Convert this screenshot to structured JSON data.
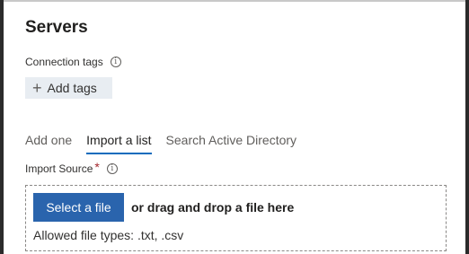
{
  "panel": {
    "title": "Servers"
  },
  "connection_tags": {
    "label": "Connection tags",
    "add_button": "Add tags"
  },
  "tabs": [
    {
      "label": "Add one",
      "active": false
    },
    {
      "label": "Import a list",
      "active": true
    },
    {
      "label": "Search Active Directory",
      "active": false
    }
  ],
  "import_source": {
    "label": "Import Source",
    "required_mark": "*",
    "select_button": "Select a file",
    "drag_text": "or drag and drop a file here",
    "allowed_types": "Allowed file types: .txt, .csv"
  },
  "colors": {
    "accent": "#0f6cbd",
    "button": "#2a64ad",
    "required": "#a4262c"
  }
}
